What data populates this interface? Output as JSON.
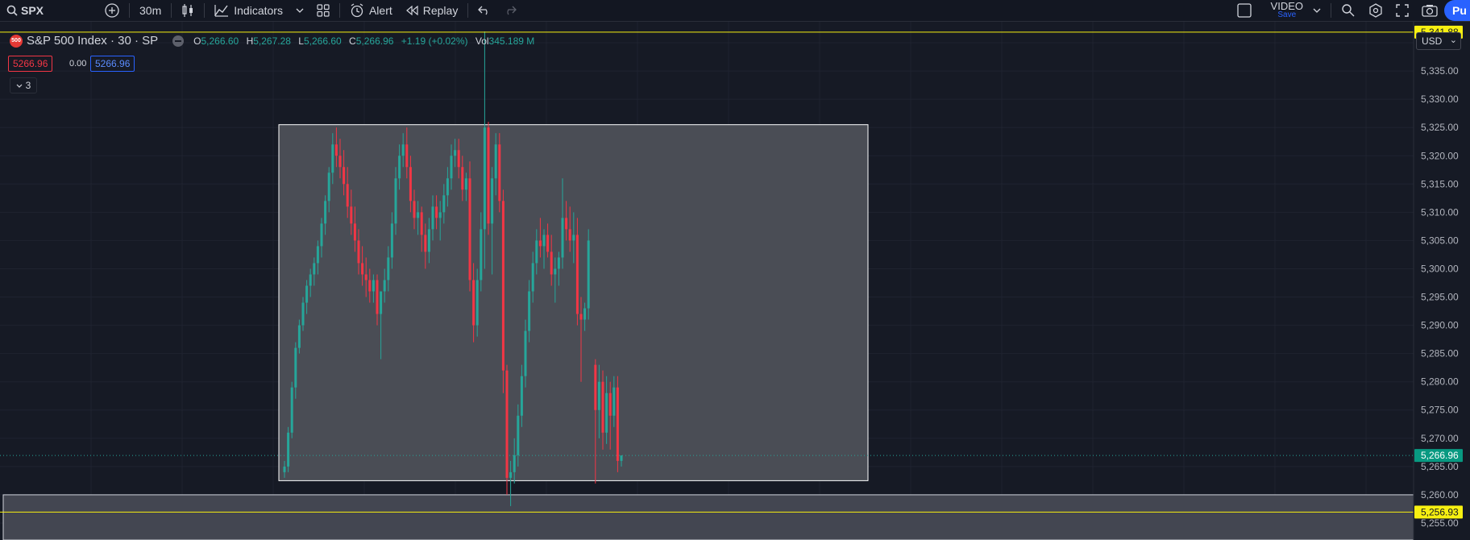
{
  "toolbar": {
    "symbol": "SPX",
    "interval": "30m",
    "indicators_label": "Indicators",
    "alert_label": "Alert",
    "replay_label": "Replay",
    "video_label": "VIDEO",
    "video_sub": "Save",
    "publish_label": "Pu"
  },
  "legend": {
    "logo_text": "500",
    "symbol_name": "S&P 500 Index · 30 · SP",
    "open_key": "O",
    "open": "5,266.60",
    "high_key": "H",
    "high": "5,267.28",
    "low_key": "L",
    "low": "5,266.60",
    "close_key": "C",
    "close": "5,266.96",
    "change": "+1.19 (+0.02%)",
    "vol_key": "Vol",
    "volume": "345.189 M"
  },
  "trade": {
    "sell_price": "5266.96",
    "spread": "0.00",
    "buy_price": "5266.96",
    "collapse_label": "3"
  },
  "currency": "USD",
  "colors": {
    "up": "#26a69a",
    "down": "#f23645",
    "hline": "#f7f011",
    "box_fill": "#4a4d55"
  },
  "axis": {
    "ticks": [
      "5,340.00",
      "5,335.00",
      "5,330.00",
      "5,325.00",
      "5,320.00",
      "5,315.00",
      "5,310.00",
      "5,305.00",
      "5,300.00",
      "5,295.00",
      "5,290.00",
      "5,285.00",
      "5,280.00",
      "5,275.00",
      "5,270.00",
      "5,265.00",
      "5,260.00",
      "5,255.00"
    ],
    "upper_line_label": "5,341.88",
    "current_label": "5,266.96",
    "lower_line_label": "5,256.93"
  },
  "chart_data": {
    "type": "candlestick",
    "ylim": [
      5252,
      5343
    ],
    "horizontal_lines": [
      5341.88,
      5256.93
    ],
    "current_price": 5266.96,
    "rectangle": {
      "top": 5325.5,
      "bottom": 5262.5
    },
    "zone": {
      "top": 5260.0,
      "bottom": 5252.0
    },
    "candles": [
      [
        5264,
        5266,
        5263,
        5265
      ],
      [
        5265,
        5272,
        5264,
        5271
      ],
      [
        5271,
        5280,
        5270,
        5279
      ],
      [
        5279,
        5287,
        5277,
        5286
      ],
      [
        5286,
        5291,
        5285,
        5290
      ],
      [
        5290,
        5295,
        5289,
        5294
      ],
      [
        5294,
        5298,
        5292,
        5297
      ],
      [
        5297,
        5300,
        5295,
        5299
      ],
      [
        5299,
        5302,
        5297,
        5301
      ],
      [
        5301,
        5305,
        5299,
        5304
      ],
      [
        5304,
        5309,
        5302,
        5308
      ],
      [
        5308,
        5313,
        5306,
        5312
      ],
      [
        5312,
        5318,
        5310,
        5317
      ],
      [
        5317,
        5324,
        5315,
        5322
      ],
      [
        5322,
        5325,
        5318,
        5320
      ],
      [
        5320,
        5323,
        5316,
        5318
      ],
      [
        5318,
        5321,
        5313,
        5315
      ],
      [
        5315,
        5318,
        5309,
        5311
      ],
      [
        5311,
        5314,
        5306,
        5308
      ],
      [
        5308,
        5311,
        5303,
        5305
      ],
      [
        5305,
        5307,
        5299,
        5301
      ],
      [
        5301,
        5304,
        5297,
        5299
      ],
      [
        5299,
        5302,
        5295,
        5298
      ],
      [
        5298,
        5300,
        5294,
        5296
      ],
      [
        5296,
        5299,
        5294,
        5298
      ],
      [
        5298,
        5299,
        5290,
        5292
      ],
      [
        5292,
        5295,
        5284,
        5296
      ],
      [
        5296,
        5300,
        5294,
        5298
      ],
      [
        5298,
        5304,
        5296,
        5302
      ],
      [
        5302,
        5310,
        5300,
        5308
      ],
      [
        5308,
        5318,
        5306,
        5316
      ],
      [
        5316,
        5322,
        5314,
        5320
      ],
      [
        5320,
        5324,
        5318,
        5322
      ],
      [
        5322,
        5325,
        5316,
        5318
      ],
      [
        5318,
        5320,
        5310,
        5312
      ],
      [
        5312,
        5314,
        5307,
        5309
      ],
      [
        5309,
        5312,
        5306,
        5310
      ],
      [
        5310,
        5311,
        5303,
        5306
      ],
      [
        5306,
        5308,
        5300,
        5303
      ],
      [
        5303,
        5309,
        5301,
        5307
      ],
      [
        5307,
        5313,
        5305,
        5311
      ],
      [
        5311,
        5313,
        5307,
        5309
      ],
      [
        5309,
        5312,
        5305,
        5310
      ],
      [
        5310,
        5315,
        5308,
        5313
      ],
      [
        5313,
        5318,
        5311,
        5316
      ],
      [
        5316,
        5322,
        5314,
        5320
      ],
      [
        5320,
        5323,
        5318,
        5321
      ],
      [
        5321,
        5323,
        5316,
        5318
      ],
      [
        5318,
        5320,
        5312,
        5314
      ],
      [
        5314,
        5317,
        5312,
        5316
      ],
      [
        5316,
        5319,
        5296,
        5298
      ],
      [
        5298,
        5301,
        5287,
        5290
      ],
      [
        5290,
        5300,
        5288,
        5298
      ],
      [
        5298,
        5310,
        5296,
        5307
      ],
      [
        5307,
        5342,
        5300,
        5325
      ],
      [
        5325,
        5326,
        5306,
        5308
      ],
      [
        5308,
        5318,
        5299,
        5316
      ],
      [
        5316,
        5324,
        5313,
        5322
      ],
      [
        5322,
        5324,
        5310,
        5312
      ],
      [
        5312,
        5314,
        5278,
        5282
      ],
      [
        5282,
        5283,
        5260,
        5263
      ],
      [
        5263,
        5266,
        5258,
        5264
      ],
      [
        5264,
        5270,
        5262,
        5267
      ],
      [
        5267,
        5276,
        5265,
        5274
      ],
      [
        5274,
        5283,
        5272,
        5281
      ],
      [
        5281,
        5291,
        5279,
        5289
      ],
      [
        5289,
        5298,
        5287,
        5296
      ],
      [
        5296,
        5303,
        5294,
        5301
      ],
      [
        5301,
        5307,
        5299,
        5305
      ],
      [
        5305,
        5309,
        5302,
        5304
      ],
      [
        5304,
        5307,
        5300,
        5306
      ],
      [
        5306,
        5308,
        5302,
        5303
      ],
      [
        5303,
        5306,
        5297,
        5299
      ],
      [
        5299,
        5302,
        5294,
        5300
      ],
      [
        5300,
        5303,
        5297,
        5302
      ],
      [
        5302,
        5316,
        5300,
        5309
      ],
      [
        5309,
        5312,
        5305,
        5307
      ],
      [
        5307,
        5311,
        5303,
        5305
      ],
      [
        5305,
        5310,
        5301,
        5306
      ],
      [
        5306,
        5309,
        5290,
        5292
      ],
      [
        5292,
        5295,
        5280,
        5291
      ],
      [
        5291,
        5294,
        5289,
        5293
      ],
      [
        5293,
        5307,
        5291,
        5305
      ],
      [
        5283,
        5284,
        5262,
        5275
      ],
      [
        5275,
        5283,
        5270,
        5280
      ],
      [
        5280,
        5282,
        5268,
        5271
      ],
      [
        5271,
        5281,
        5269,
        5278
      ],
      [
        5278,
        5280,
        5268,
        5274
      ],
      [
        5274,
        5281,
        5272,
        5279
      ],
      [
        5279,
        5281,
        5264,
        5266
      ],
      [
        5266,
        5267,
        5265,
        5266.96
      ]
    ]
  }
}
